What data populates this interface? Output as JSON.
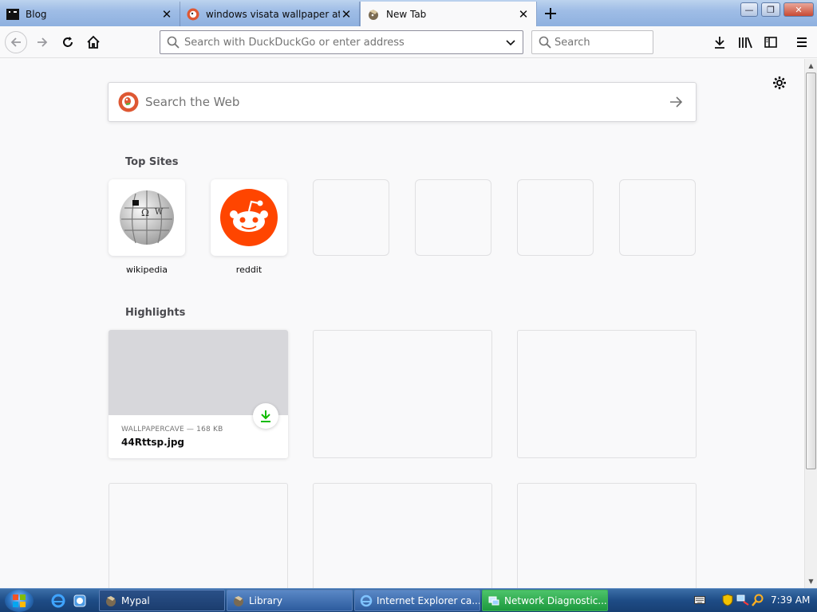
{
  "tabs": [
    {
      "title": "Blog",
      "icon": "blog-favicon"
    },
    {
      "title": "windows visata wallpaper at DuckDuckGo",
      "icon": "duckduckgo-favicon"
    },
    {
      "title": "New Tab",
      "icon": "firefox-favicon"
    }
  ],
  "window_controls": {
    "minimize": "—",
    "restore": "❐",
    "close": "✕"
  },
  "urlbar": {
    "placeholder": "Search with DuckDuckGo or enter address"
  },
  "searchbar": {
    "placeholder": "Search"
  },
  "content": {
    "websearch_placeholder": "Search the Web",
    "top_sites_title": "Top Sites",
    "top_sites": [
      {
        "label": "wikipedia",
        "icon": "wikipedia-icon"
      },
      {
        "label": "reddit",
        "icon": "reddit-icon"
      },
      {
        "label": ""
      },
      {
        "label": ""
      },
      {
        "label": ""
      },
      {
        "label": ""
      }
    ],
    "highlights_title": "Highlights",
    "highlights": [
      {
        "source": "WALLPAPERCAVE — 168 KB",
        "filename": "44Rttsp.jpg"
      }
    ]
  },
  "taskbar": {
    "tasks": [
      {
        "label": "Mypal",
        "icon": "mypal-icon"
      },
      {
        "label": "Library",
        "icon": "library-icon"
      },
      {
        "label": "Internet Explorer ca...",
        "icon": "ie-icon"
      },
      {
        "label": "Network Diagnostic...",
        "icon": "network-icon"
      }
    ],
    "clock": "7:39 AM"
  },
  "colors": {
    "accent_green": "#12bc00",
    "reddit": "#ff4500",
    "ddg": "#de5833"
  }
}
